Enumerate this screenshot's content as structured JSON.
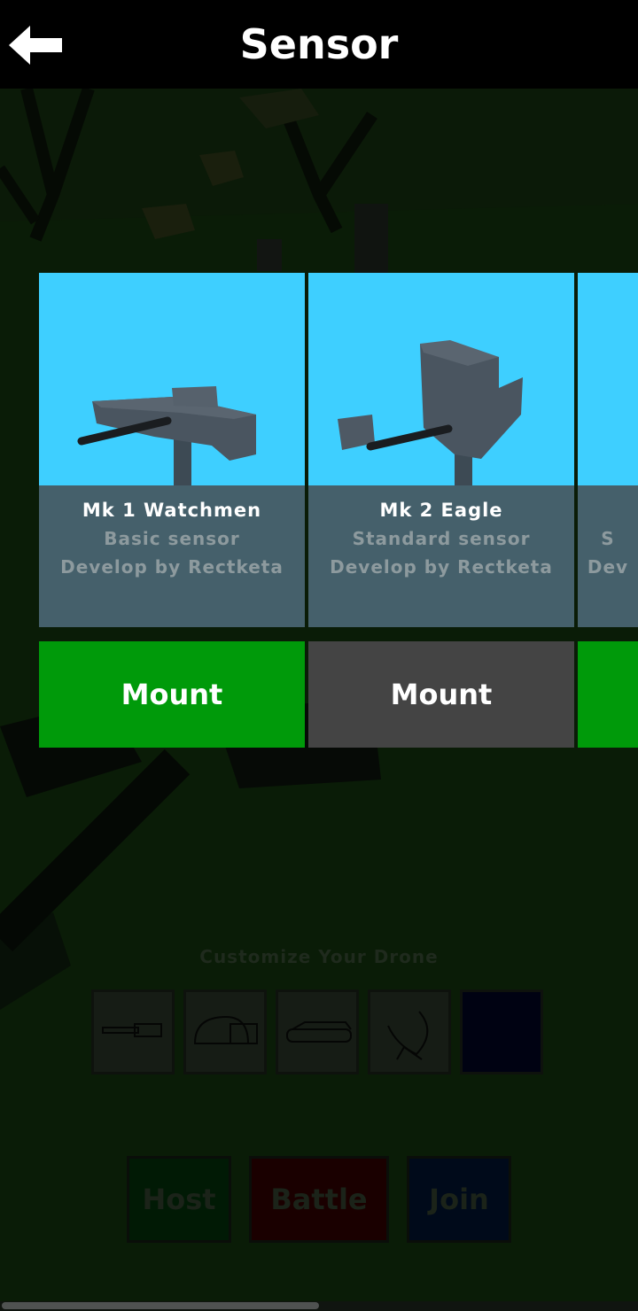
{
  "header": {
    "title": "Sensor",
    "back_icon": "arrow-left-icon"
  },
  "cards": [
    {
      "name": "Mk 1 Watchmen",
      "description": "Basic sensor",
      "developer": "Develop by Rectketa",
      "button_label": "Mount",
      "button_color": "#009a0a"
    },
    {
      "name": "Mk 2 Eagle",
      "description": "Standard sensor",
      "developer": "Develop by Rectketa",
      "button_label": "Mount",
      "button_color": "#444444"
    },
    {
      "name": "",
      "description": "S",
      "developer": "Dev",
      "button_label": "",
      "button_color": "#009a0a"
    }
  ],
  "customize": {
    "label": "Customize Your Drone",
    "slots": [
      "gun-icon",
      "dome-icon",
      "tank-tread-icon",
      "radar-dish-icon",
      "empty-slot"
    ]
  },
  "menu": {
    "host_label": "Host",
    "battle_label": "Battle",
    "join_label": "Join"
  },
  "colors": {
    "preview_bg": "#3ecfff",
    "info_bg": "#45606b",
    "mount_active": "#009a0a",
    "mount_inactive": "#444444"
  }
}
